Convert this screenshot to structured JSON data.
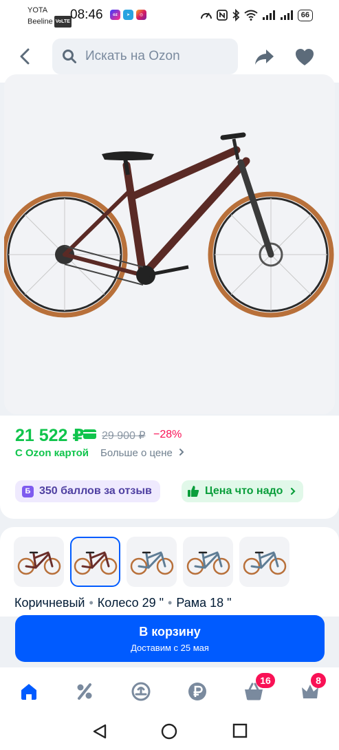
{
  "status_bar": {
    "carrier1": "YOTA",
    "carrier2": "Beeline",
    "volte": "VoLTE",
    "time": "08:46",
    "battery": "66"
  },
  "header": {
    "search_placeholder": "Искать на Ozon"
  },
  "price": {
    "current": "21 522 ₽",
    "old": "29 900 ₽",
    "discount": "−28%",
    "with_card": "С Ozon картой",
    "more": "Больше о цене"
  },
  "promo": {
    "points_icon": "Б",
    "points": "350 баллов за отзыв",
    "deal": "Цена что надо"
  },
  "variants": {
    "selected_index": 1,
    "colors": [
      "#6b2e2a",
      "#6b2e2a",
      "#5f7d95",
      "#5f7d95",
      "#5f7d95"
    ],
    "specs": [
      "Коричневый",
      "Колесо 29 \"",
      "Рама 18 \""
    ]
  },
  "cart": {
    "label": "В корзину",
    "delivery": "Доставим с 25 мая"
  },
  "tabbar": {
    "cart_badge": "16",
    "profile_badge": "8"
  }
}
